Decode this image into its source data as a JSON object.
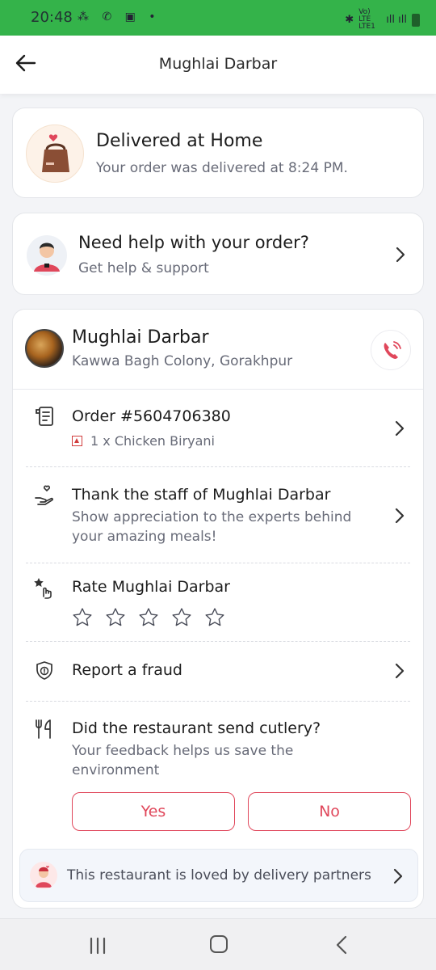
{
  "status_bar": {
    "time": "20:48",
    "network": "Vo) LTE LTE1"
  },
  "header": {
    "title": "Mughlai Darbar"
  },
  "delivery": {
    "title": "Delivered at Home",
    "subtitle": "Your order was delivered at 8:24 PM."
  },
  "help": {
    "title": "Need help with your order?",
    "subtitle": "Get help & support"
  },
  "restaurant": {
    "name": "Mughlai Darbar",
    "location": "Kawwa Bagh Colony, Gorakhpur"
  },
  "order": {
    "title": "Order #5604706380",
    "items": "1 x Chicken Biryani"
  },
  "thank": {
    "title": "Thank the staff of Mughlai Darbar",
    "subtitle": "Show appreciation to the experts behind your amazing meals!"
  },
  "rate": {
    "title": "Rate Mughlai Darbar",
    "rating": 0,
    "max_rating": 5
  },
  "fraud": {
    "title": "Report a fraud"
  },
  "cutlery": {
    "title": "Did the restaurant send cutlery?",
    "subtitle": "Your feedback helps us save the environment",
    "yes_label": "Yes",
    "no_label": "No"
  },
  "loved": {
    "text": "This restaurant is loved by delivery partners"
  },
  "colors": {
    "accent": "#e0475b",
    "status_bar": "#34b34a",
    "muted_text": "#686b78"
  },
  "icons": [
    "arrow-left-icon",
    "food-bag-icon",
    "support-agent-icon",
    "chevron-right-icon",
    "phone-icon",
    "receipt-icon",
    "heart-hand-icon",
    "star-tap-icon",
    "star-outline-icon",
    "shield-icon",
    "cutlery-icon",
    "delivery-partner-icon"
  ]
}
